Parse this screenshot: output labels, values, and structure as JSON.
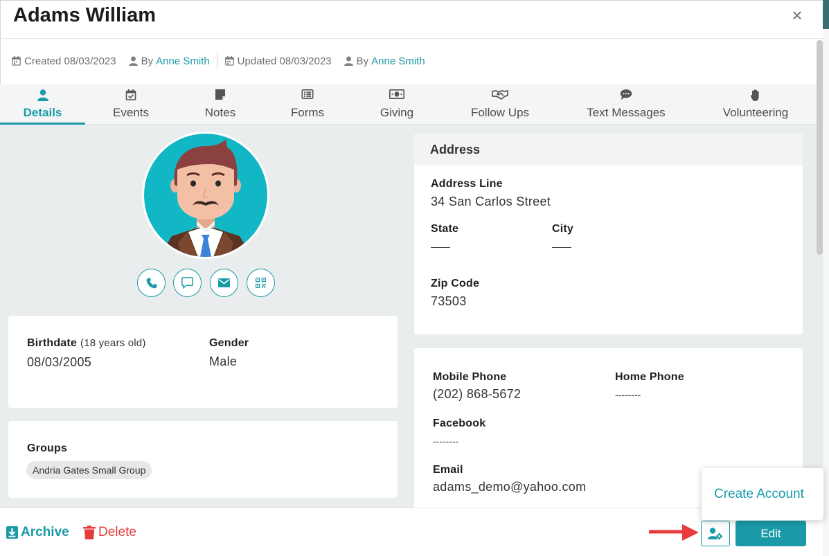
{
  "modal": {
    "title": "Adams William",
    "close_glyph": "×"
  },
  "meta": {
    "created_label": "Created 08/03/2023",
    "created_by_prefix": "By",
    "created_by_name": "Anne Smith",
    "updated_label": "Updated 08/03/2023",
    "updated_by_prefix": "By",
    "updated_by_name": "Anne Smith"
  },
  "tabs": [
    {
      "label": "Details",
      "icon": "person-icon",
      "active": true
    },
    {
      "label": "Events",
      "icon": "calendar-check-icon"
    },
    {
      "label": "Notes",
      "icon": "note-icon"
    },
    {
      "label": "Forms",
      "icon": "form-list-icon"
    },
    {
      "label": "Giving",
      "icon": "money-icon"
    },
    {
      "label": "Follow Ups",
      "icon": "handshake-icon"
    },
    {
      "label": "Text Messages",
      "icon": "chat-bubble-icon"
    },
    {
      "label": "Volunteering",
      "icon": "raised-hand-icon"
    }
  ],
  "profile": {
    "contact_actions": [
      "phone-icon",
      "message-icon",
      "email-icon",
      "qr-code-icon"
    ]
  },
  "personal": {
    "birthdate_label": "Birthdate",
    "birthdate_age": "(18 years old)",
    "birthdate_value": "08/03/2005",
    "gender_label": "Gender",
    "gender_value": "Male"
  },
  "groups": {
    "label": "Groups",
    "items": [
      "Andria Gates Small Group"
    ]
  },
  "address": {
    "heading": "Address",
    "line_label": "Address Line",
    "line_value": "34 San Carlos Street",
    "state_label": "State",
    "state_value": "——",
    "city_label": "City",
    "city_value": "——",
    "zip_label": "Zip Code",
    "zip_value": "73503"
  },
  "contact": {
    "mobile_label": "Mobile Phone",
    "mobile_value": "(202) 868-5672",
    "home_label": "Home Phone",
    "home_value": "--------",
    "facebook_label": "Facebook",
    "facebook_value": "--------",
    "email_label": "Email",
    "email_value": "adams_demo@yahoo.com"
  },
  "footer": {
    "archive_label": "Archive",
    "delete_label": "Delete",
    "edit_label": "Edit",
    "account_icon": "user-gear-icon"
  },
  "popover": {
    "create_account_label": "Create Account"
  },
  "colors": {
    "accent": "#1a9aa8",
    "danger": "#e53b3b",
    "annotation_arrow": "#e83b3b"
  }
}
